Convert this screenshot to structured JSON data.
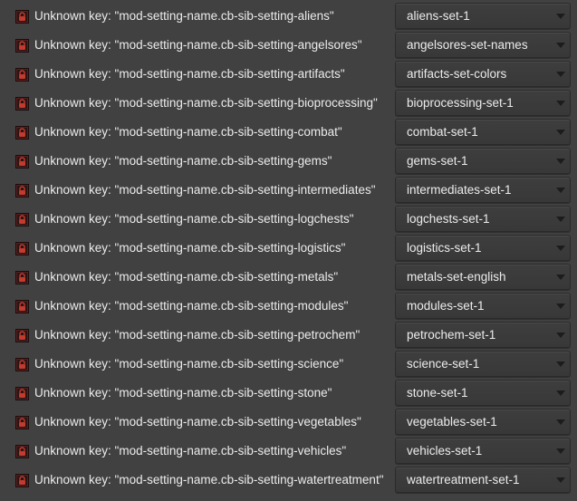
{
  "settings": [
    {
      "label": "Unknown key: \"mod-setting-name.cb-sib-setting-aliens\"",
      "value": "aliens-set-1"
    },
    {
      "label": "Unknown key: \"mod-setting-name.cb-sib-setting-angelsores\"",
      "value": "angelsores-set-names"
    },
    {
      "label": "Unknown key: \"mod-setting-name.cb-sib-setting-artifacts\"",
      "value": "artifacts-set-colors"
    },
    {
      "label": "Unknown key: \"mod-setting-name.cb-sib-setting-bioprocessing\"",
      "value": "bioprocessing-set-1"
    },
    {
      "label": "Unknown key: \"mod-setting-name.cb-sib-setting-combat\"",
      "value": "combat-set-1"
    },
    {
      "label": "Unknown key: \"mod-setting-name.cb-sib-setting-gems\"",
      "value": "gems-set-1"
    },
    {
      "label": "Unknown key: \"mod-setting-name.cb-sib-setting-intermediates\"",
      "value": "intermediates-set-1"
    },
    {
      "label": "Unknown key: \"mod-setting-name.cb-sib-setting-logchests\"",
      "value": "logchests-set-1"
    },
    {
      "label": "Unknown key: \"mod-setting-name.cb-sib-setting-logistics\"",
      "value": "logistics-set-1"
    },
    {
      "label": "Unknown key: \"mod-setting-name.cb-sib-setting-metals\"",
      "value": "metals-set-english"
    },
    {
      "label": "Unknown key: \"mod-setting-name.cb-sib-setting-modules\"",
      "value": "modules-set-1"
    },
    {
      "label": "Unknown key: \"mod-setting-name.cb-sib-setting-petrochem\"",
      "value": "petrochem-set-1"
    },
    {
      "label": "Unknown key: \"mod-setting-name.cb-sib-setting-science\"",
      "value": "science-set-1"
    },
    {
      "label": "Unknown key: \"mod-setting-name.cb-sib-setting-stone\"",
      "value": "stone-set-1"
    },
    {
      "label": "Unknown key: \"mod-setting-name.cb-sib-setting-vegetables\"",
      "value": "vegetables-set-1"
    },
    {
      "label": "Unknown key: \"mod-setting-name.cb-sib-setting-vehicles\"",
      "value": "vehicles-set-1"
    },
    {
      "label": "Unknown key: \"mod-setting-name.cb-sib-setting-watertreatment\"",
      "value": "watertreatment-set-1"
    }
  ],
  "icon": "per-map-setting-lock-icon",
  "colors": {
    "background": "#414141",
    "text": "#ececec",
    "icon_red": "#c23b2e"
  }
}
